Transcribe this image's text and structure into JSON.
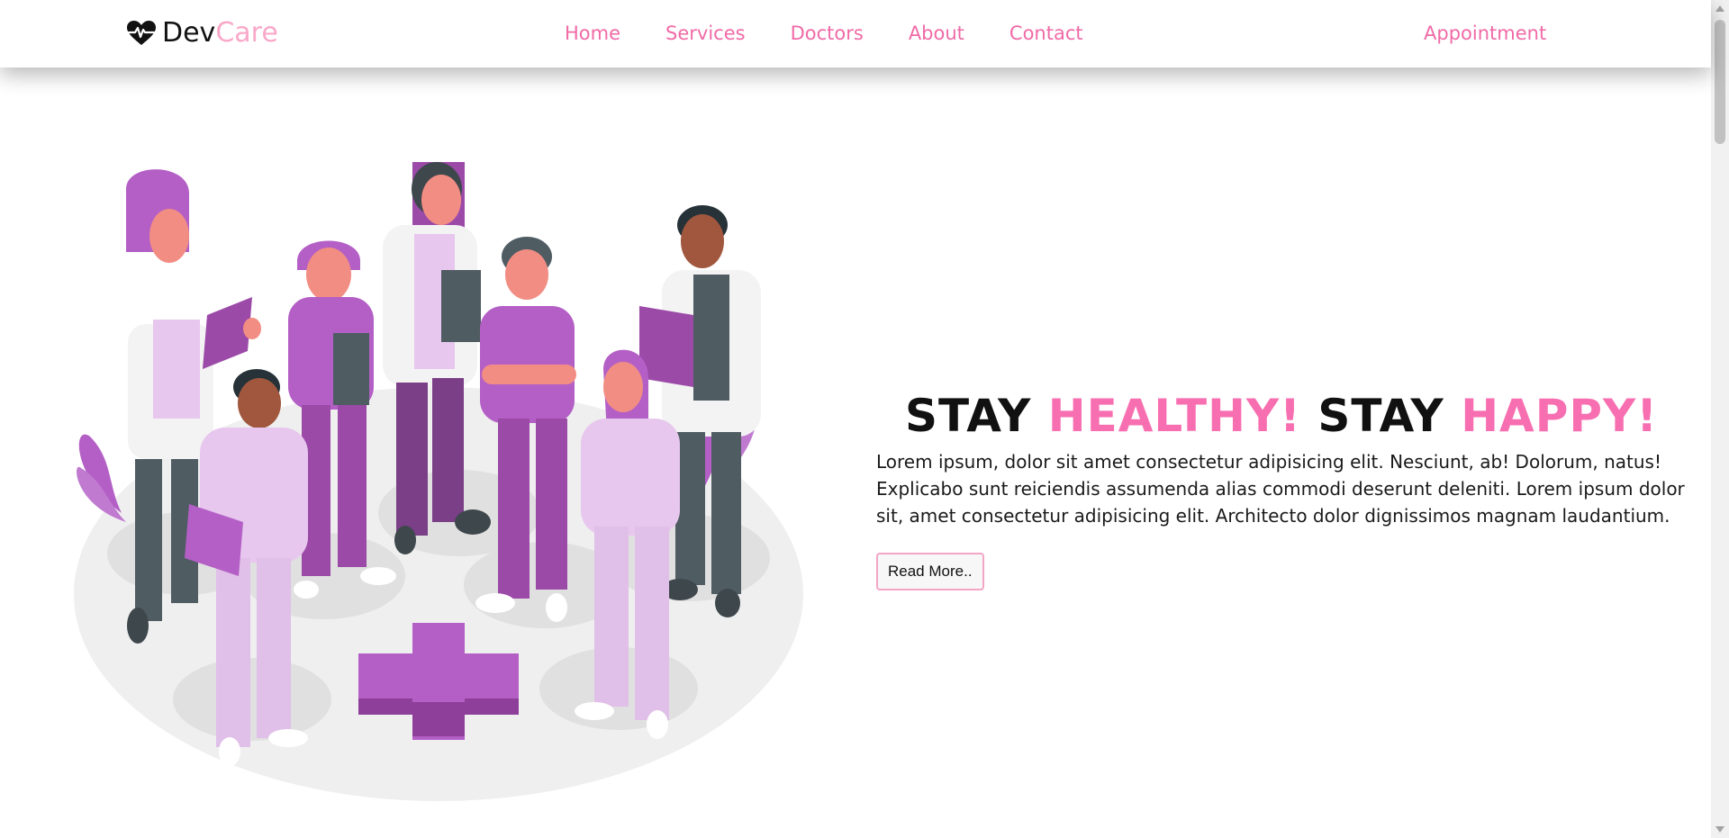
{
  "brand": {
    "part1": "Dev",
    "part2": "Care",
    "icon": "heart-pulse-icon"
  },
  "nav": {
    "links": [
      "Home",
      "Services",
      "Doctors",
      "About",
      "Contact"
    ],
    "appointment": "Appointment"
  },
  "hero": {
    "title": {
      "w1": "STAY",
      "w2": "HEALTHY!",
      "w3": "STAY",
      "w4": "HAPPY!"
    },
    "body": "Lorem ipsum, dolor sit amet consectetur adipisicing elit. Nesciunt, ab! Dolorum, natus! Explicabo sunt reiciendis assumenda alias commodi deserunt deleniti. Lorem ipsum dolor sit, amet consectetur adipisicing elit. Architecto dolor dignissimos magnam laudantium.",
    "button": "Read More..",
    "illustration": "medical-team-illustration"
  },
  "colors": {
    "accent": "#f06aa6",
    "brand_light": "#f9a8c9",
    "purple": "#b45fc6"
  }
}
